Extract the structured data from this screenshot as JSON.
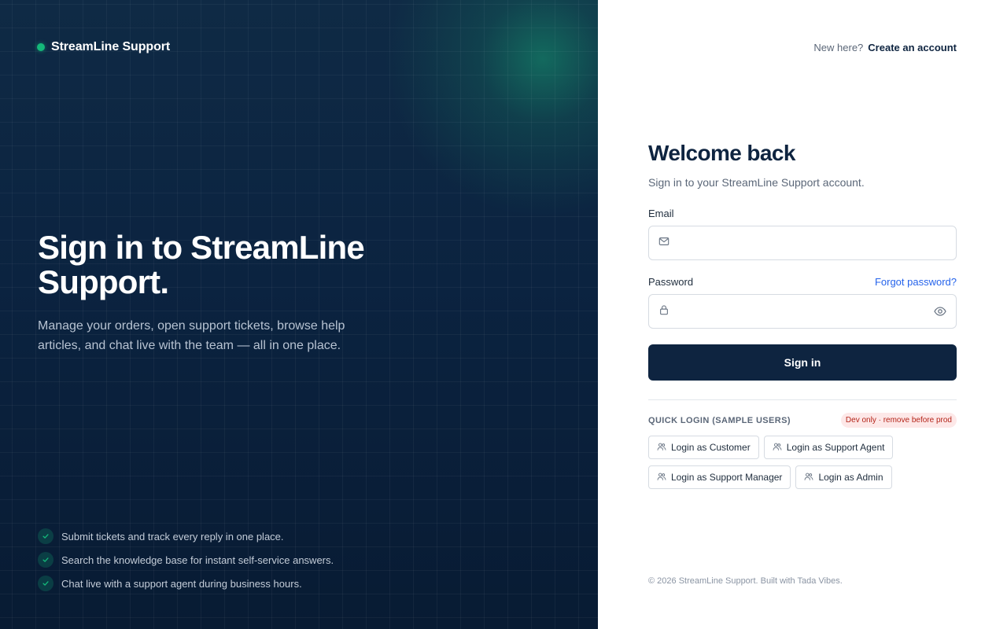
{
  "brand": {
    "name": "StreamLine Support",
    "accent": "#14b87a"
  },
  "hero": {
    "title": "Sign in to StreamLine Support.",
    "description": "Manage your orders, open support tickets, browse help articles, and chat live with the team — all in one place."
  },
  "features": [
    "Submit tickets and track every reply in one place.",
    "Search the knowledge base for instant self-service answers.",
    "Chat live with a support agent during business hours."
  ],
  "topnav": {
    "prompt": "New here?",
    "link": "Create an account"
  },
  "form": {
    "title": "Welcome back",
    "subtitle": "Sign in to your StreamLine Support account.",
    "email_label": "Email",
    "email_value": "",
    "password_label": "Password",
    "password_value": "",
    "forgot_link": "Forgot password?",
    "submit_label": "Sign in"
  },
  "quick_login": {
    "label": "QUICK LOGIN (SAMPLE USERS)",
    "badge": "Dev only · remove before prod",
    "buttons": [
      "Login as Customer",
      "Login as Support Agent",
      "Login as Support Manager",
      "Login as Admin"
    ]
  },
  "footer": {
    "text": "© 2026 StreamLine Support. Built with Tada Vibes."
  },
  "colors": {
    "navy": "#0e2440",
    "link_blue": "#2563eb",
    "badge_bg": "#fde8e8",
    "badge_text": "#b42318"
  }
}
